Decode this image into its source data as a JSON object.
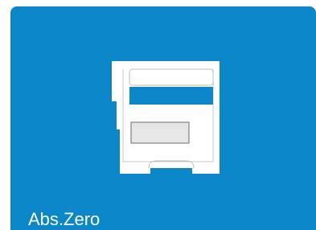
{
  "tile": {
    "label": "Abs.Zero",
    "icon": "sd-card-slot-icon",
    "background_color": "#0a86c9",
    "icon_color": "#ffffff",
    "icon_window_color": "#0a86c9",
    "icon_label_area_color": "#e6e6e6"
  }
}
